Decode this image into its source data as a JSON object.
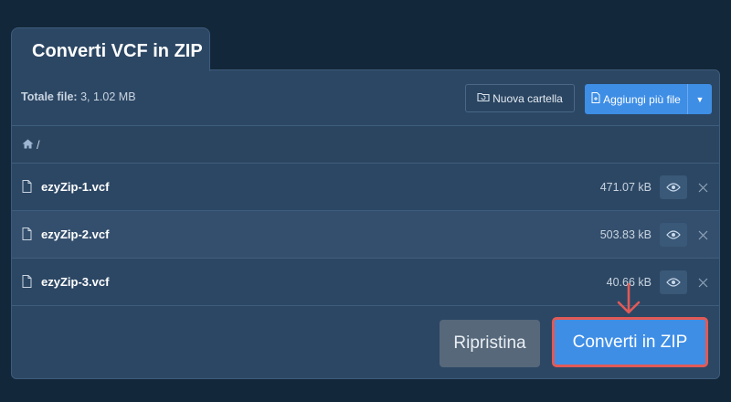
{
  "tab": {
    "title": "Converti VCF in ZIP"
  },
  "toolbar": {
    "total_label": "Totale file:",
    "total_value": "3, 1.02 MB",
    "new_folder_label": "Nuova cartella",
    "add_files_label": "Aggiungi più file"
  },
  "breadcrumb": {
    "separator": "/"
  },
  "files": [
    {
      "name": "ezyZip-1.vcf",
      "size": "471.07 kB"
    },
    {
      "name": "ezyZip-2.vcf",
      "size": "503.83 kB"
    },
    {
      "name": "ezyZip-3.vcf",
      "size": "40.66 kB"
    }
  ],
  "actions": {
    "reset_label": "Ripristina",
    "convert_label": "Converti in ZIP"
  },
  "colors": {
    "background": "#13273a",
    "panel": "#2c4764",
    "accent": "#3e8ee6",
    "highlight": "#e15a57"
  },
  "icons": {
    "folder": "folder-refresh-icon",
    "add": "file-add-icon",
    "caret": "caret-down-icon",
    "home": "home-icon",
    "file": "file-icon",
    "preview": "eye-icon",
    "remove": "close-icon",
    "arrow": "arrow-down-icon"
  }
}
